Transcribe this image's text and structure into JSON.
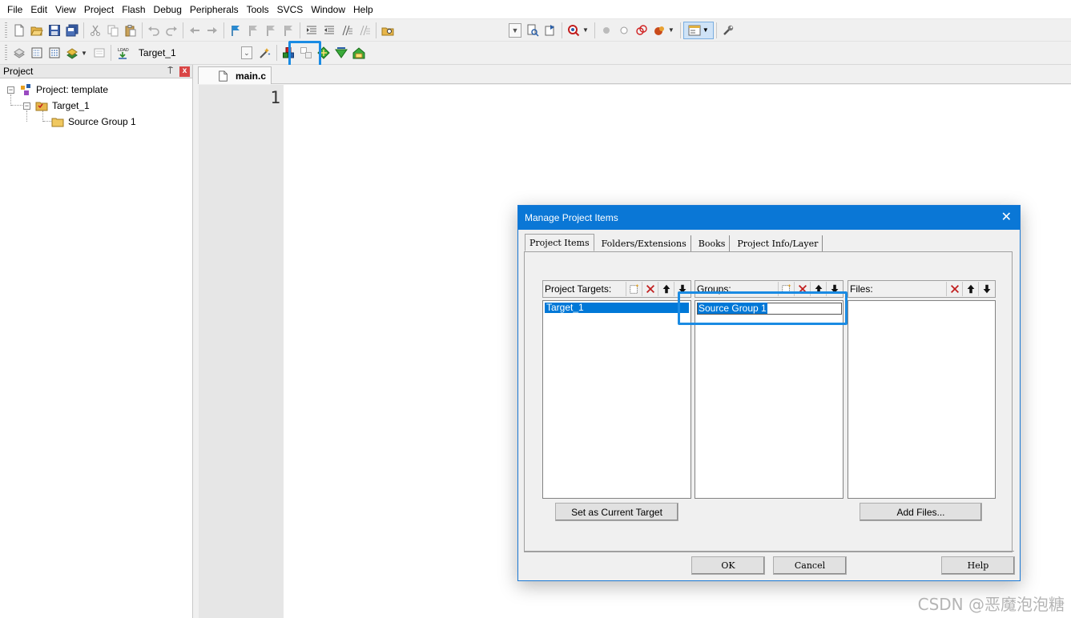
{
  "menu": [
    "File",
    "Edit",
    "View",
    "Project",
    "Flash",
    "Debug",
    "Peripherals",
    "Tools",
    "SVCS",
    "Window",
    "Help"
  ],
  "toolbar": {
    "target_select": "Target_1",
    "highlighted_button_icon": "manage-project-items-icon"
  },
  "project_panel": {
    "title": "Project",
    "pin_glyph": "⍑",
    "close_glyph": "x",
    "tree": {
      "project": "Project: template",
      "target": "Target_1",
      "group": "Source Group 1"
    }
  },
  "editor": {
    "tab": "main.c",
    "line_number": "1"
  },
  "dialog": {
    "title": "Manage Project Items",
    "close_glyph": "✕",
    "tabs": [
      "Project Items",
      "Folders/Extensions",
      "Books",
      "Project Info/Layer"
    ],
    "targets": {
      "header": "Project Targets:",
      "items": [
        "Target_1"
      ]
    },
    "groups": {
      "header": "Groups:",
      "editing_value": "Source Group 1"
    },
    "files": {
      "header": "Files:"
    },
    "set_current_target": "Set as Current Target",
    "add_files": "Add Files...",
    "ok": "OK",
    "cancel": "Cancel",
    "help": "Help"
  },
  "colors": {
    "accent": "#0a77d6",
    "highlight_box": "#1a8be3",
    "selection": "#0078d7"
  },
  "watermark": "CSDN @恶魔泡泡糖"
}
